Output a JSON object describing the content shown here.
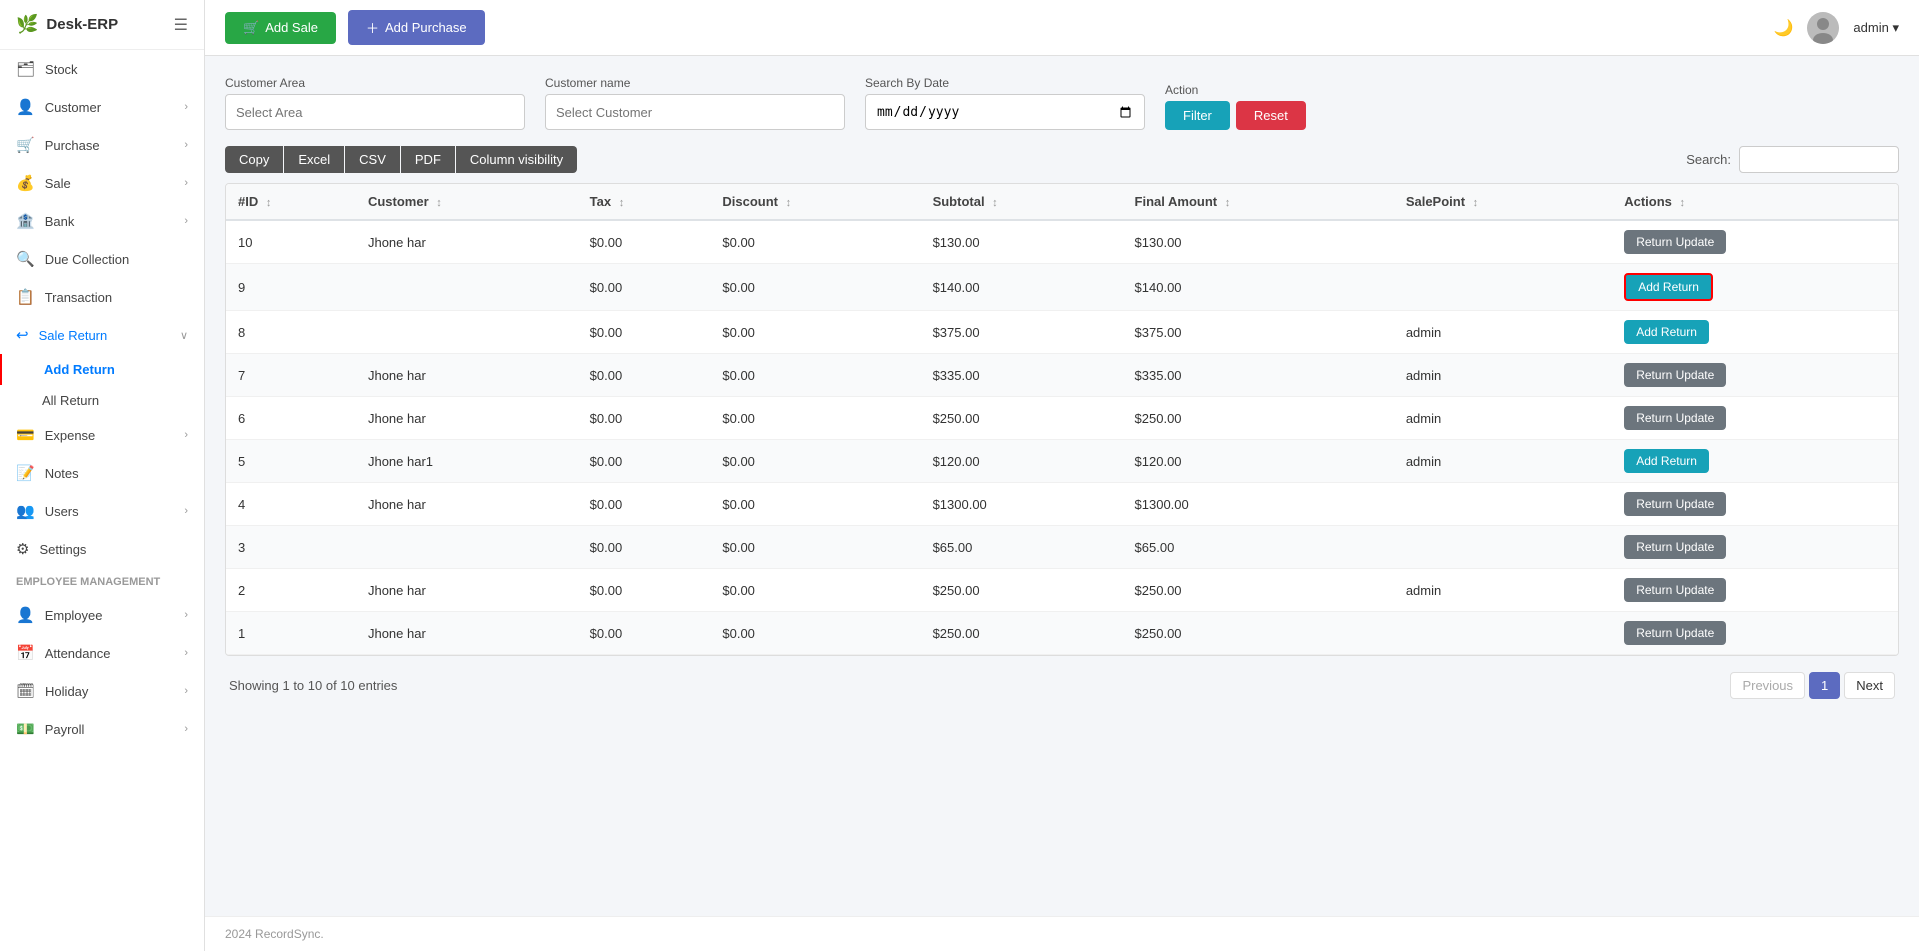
{
  "app": {
    "name": "Desk-ERP"
  },
  "topbar": {
    "add_sale_label": "Add Sale",
    "add_purchase_label": "Add Purchase",
    "admin_label": "admin",
    "admin_arrow": "▾"
  },
  "sidebar": {
    "items": [
      {
        "id": "stock",
        "label": "Stock",
        "icon": "🗂",
        "has_arrow": false
      },
      {
        "id": "customer",
        "label": "Customer",
        "icon": "👤",
        "has_arrow": true
      },
      {
        "id": "purchase",
        "label": "Purchase",
        "icon": "🛒",
        "has_arrow": true
      },
      {
        "id": "sale",
        "label": "Sale",
        "icon": "💰",
        "has_arrow": true
      },
      {
        "id": "bank",
        "label": "Bank",
        "icon": "🏦",
        "has_arrow": true
      },
      {
        "id": "due-collection",
        "label": "Due Collection",
        "icon": "🔍",
        "has_arrow": false
      },
      {
        "id": "transaction",
        "label": "Transaction",
        "icon": "📋",
        "has_arrow": false
      },
      {
        "id": "sale-return",
        "label": "Sale Return",
        "icon": "↩",
        "has_arrow": true,
        "active": true
      }
    ],
    "sale_return_children": [
      {
        "id": "add-return",
        "label": "Add Return",
        "active": true
      },
      {
        "id": "all-return",
        "label": "All Return",
        "active": false
      }
    ],
    "bottom_items": [
      {
        "id": "expense",
        "label": "Expense",
        "icon": "💳",
        "has_arrow": true
      },
      {
        "id": "notes",
        "label": "Notes",
        "icon": "📝",
        "has_arrow": false
      },
      {
        "id": "users",
        "label": "Users",
        "icon": "👥",
        "has_arrow": true
      },
      {
        "id": "settings",
        "label": "Settings",
        "icon": "⚙",
        "has_arrow": false
      }
    ],
    "employee_section_label": "Employee Management",
    "employee_items": [
      {
        "id": "employee",
        "label": "Employee",
        "icon": "👤",
        "has_arrow": true
      },
      {
        "id": "attendance",
        "label": "Attendance",
        "icon": "📅",
        "has_arrow": true
      },
      {
        "id": "holiday",
        "label": "Holiday",
        "icon": "🗓",
        "has_arrow": true
      },
      {
        "id": "payroll",
        "label": "Payroll",
        "icon": "💵",
        "has_arrow": true
      }
    ]
  },
  "filters": {
    "customer_area_label": "Customer Area",
    "customer_area_placeholder": "Select Area",
    "customer_name_label": "Customer name",
    "customer_name_placeholder": "Select Customer",
    "search_by_date_label": "Search By Date",
    "date_placeholder": "mm/dd/yyyy",
    "action_label": "Action",
    "filter_btn": "Filter",
    "reset_btn": "Reset"
  },
  "table_toolbar": {
    "copy": "Copy",
    "excel": "Excel",
    "csv": "CSV",
    "pdf": "PDF",
    "column_visibility": "Column visibility",
    "search_label": "Search:"
  },
  "table": {
    "columns": [
      "#ID",
      "Customer",
      "Tax",
      "Discount",
      "Subtotal",
      "Final Amount",
      "SalePoint",
      "Actions"
    ],
    "rows": [
      {
        "id": "10",
        "customer": "Jhone har",
        "tax": "$0.00",
        "discount": "$0.00",
        "subtotal": "$130.00",
        "final_amount": "$130.00",
        "salepoint": "",
        "action_type": "return_update"
      },
      {
        "id": "9",
        "customer": "",
        "tax": "$0.00",
        "discount": "$0.00",
        "subtotal": "$140.00",
        "final_amount": "$140.00",
        "salepoint": "",
        "action_type": "add_return_highlighted"
      },
      {
        "id": "8",
        "customer": "",
        "tax": "$0.00",
        "discount": "$0.00",
        "subtotal": "$375.00",
        "final_amount": "$375.00",
        "salepoint": "admin",
        "action_type": "add_return"
      },
      {
        "id": "7",
        "customer": "Jhone har",
        "tax": "$0.00",
        "discount": "$0.00",
        "subtotal": "$335.00",
        "final_amount": "$335.00",
        "salepoint": "admin",
        "action_type": "return_update"
      },
      {
        "id": "6",
        "customer": "Jhone har",
        "tax": "$0.00",
        "discount": "$0.00",
        "subtotal": "$250.00",
        "final_amount": "$250.00",
        "salepoint": "admin",
        "action_type": "return_update"
      },
      {
        "id": "5",
        "customer": "Jhone har1",
        "tax": "$0.00",
        "discount": "$0.00",
        "subtotal": "$120.00",
        "final_amount": "$120.00",
        "salepoint": "admin",
        "action_type": "add_return"
      },
      {
        "id": "4",
        "customer": "Jhone har",
        "tax": "$0.00",
        "discount": "$0.00",
        "subtotal": "$1300.00",
        "final_amount": "$1300.00",
        "salepoint": "",
        "action_type": "return_update"
      },
      {
        "id": "3",
        "customer": "",
        "tax": "$0.00",
        "discount": "$0.00",
        "subtotal": "$65.00",
        "final_amount": "$65.00",
        "salepoint": "",
        "action_type": "return_update"
      },
      {
        "id": "2",
        "customer": "Jhone har",
        "tax": "$0.00",
        "discount": "$0.00",
        "subtotal": "$250.00",
        "final_amount": "$250.00",
        "salepoint": "admin",
        "action_type": "return_update"
      },
      {
        "id": "1",
        "customer": "Jhone har",
        "tax": "$0.00",
        "discount": "$0.00",
        "subtotal": "$250.00",
        "final_amount": "$250.00",
        "salepoint": "",
        "action_type": "return_update"
      }
    ],
    "action_labels": {
      "return_update": "Return Update",
      "add_return": "Add Return"
    }
  },
  "pagination": {
    "showing_text": "Showing 1 to 10 of 10 entries",
    "previous": "Previous",
    "page1": "1",
    "next": "Next"
  },
  "footer": {
    "text": "2024 RecordSync."
  }
}
